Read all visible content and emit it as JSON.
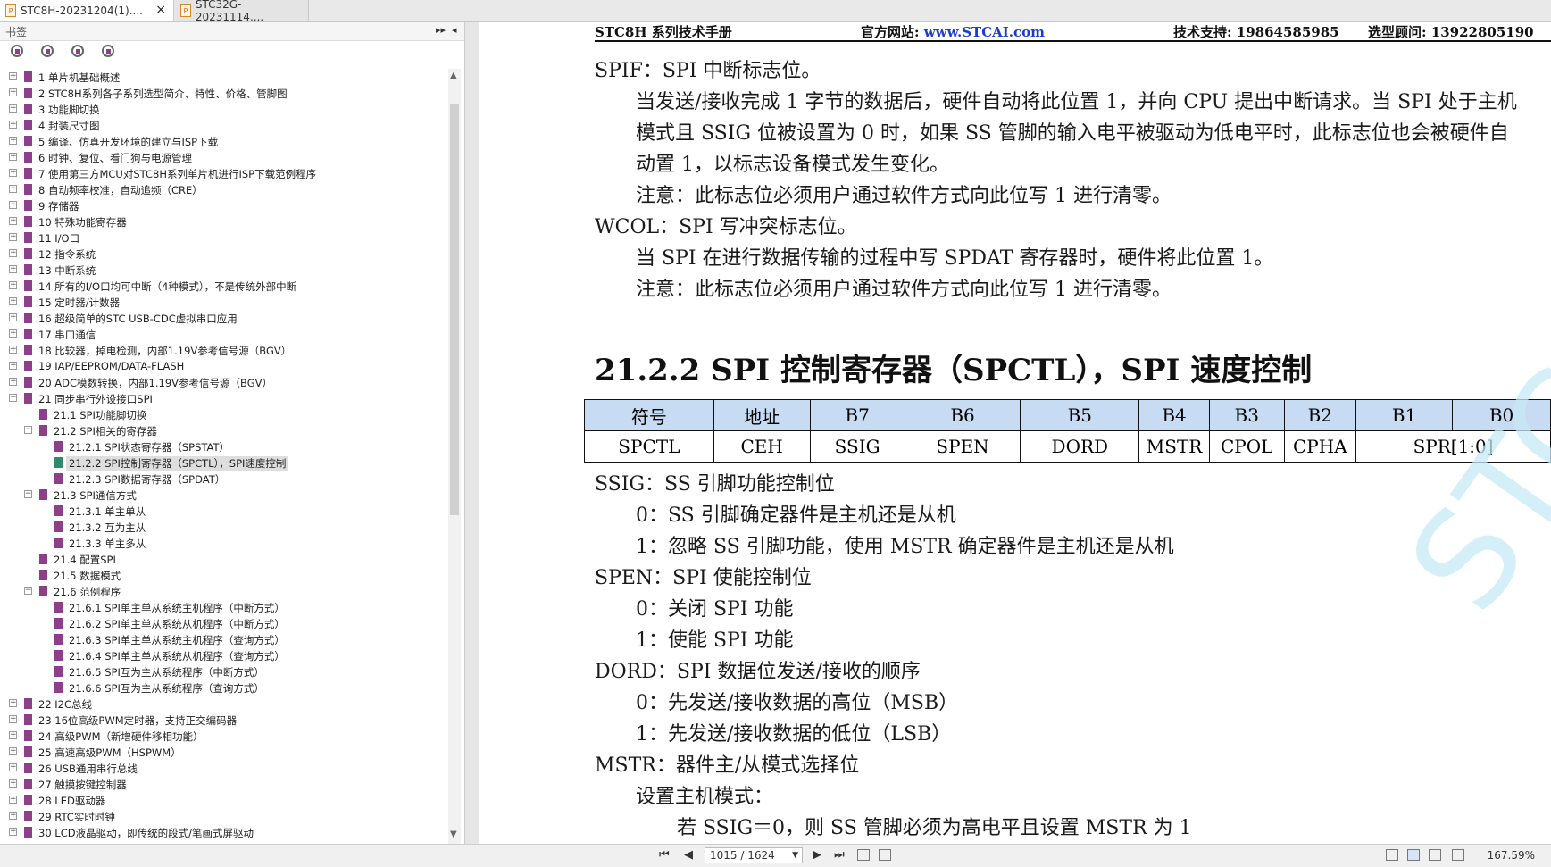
{
  "tabs": [
    {
      "label": "STC8H-20231204(1)....",
      "close": "×"
    },
    {
      "label": "STC32G-20231114...."
    }
  ],
  "sidebar": {
    "title": "书签",
    "controls": [
      "▸▸",
      "◂"
    ],
    "items": [
      {
        "level": 0,
        "exp": "+",
        "label": "1 单片机基础概述"
      },
      {
        "level": 0,
        "exp": "+",
        "label": "2  STC8H系列各子系列选型简介、特性、价格、管脚图"
      },
      {
        "level": 0,
        "exp": "+",
        "label": "3  功能脚切换"
      },
      {
        "level": 0,
        "exp": "+",
        "label": "4  封装尺寸图"
      },
      {
        "level": 0,
        "exp": "+",
        "label": "5  编译、仿真开发环境的建立与ISP下载"
      },
      {
        "level": 0,
        "exp": "+",
        "label": "6  时钟、复位、看门狗与电源管理"
      },
      {
        "level": 0,
        "exp": "+",
        "label": "7  使用第三方MCU对STC8H系列单片机进行ISP下载范例程序"
      },
      {
        "level": 0,
        "exp": "+",
        "label": "8  自动频率校准，自动追频（CRE）"
      },
      {
        "level": 0,
        "exp": "+",
        "label": "9  存储器"
      },
      {
        "level": 0,
        "exp": "+",
        "label": "10  特殊功能寄存器"
      },
      {
        "level": 0,
        "exp": "+",
        "label": "11  I/O口"
      },
      {
        "level": 0,
        "exp": "+",
        "label": "12  指令系统"
      },
      {
        "level": 0,
        "exp": "+",
        "label": "13  中断系统"
      },
      {
        "level": 0,
        "exp": "+",
        "label": "14  所有的I/O口均可中断（4种模式），不是传统外部中断"
      },
      {
        "level": 0,
        "exp": "+",
        "label": "15  定时器/计数器"
      },
      {
        "level": 0,
        "exp": "+",
        "label": "16  超级简单的STC USB-CDC虚拟串口应用"
      },
      {
        "level": 0,
        "exp": "+",
        "label": "17  串口通信"
      },
      {
        "level": 0,
        "exp": "+",
        "label": "18  比较器，掉电检测，内部1.19V参考信号源（BGV）"
      },
      {
        "level": 0,
        "exp": "+",
        "label": "19  IAP/EEPROM/DATA-FLASH"
      },
      {
        "level": 0,
        "exp": "+",
        "label": "20  ADC模数转换，内部1.19V参考信号源（BGV）"
      },
      {
        "level": 0,
        "exp": "−",
        "label": "21  同步串行外设接口SPI"
      },
      {
        "level": 1,
        "exp": "",
        "label": "21.1 SPI功能脚切换"
      },
      {
        "level": 1,
        "exp": "−",
        "label": "21.2 SPI相关的寄存器"
      },
      {
        "level": 2,
        "exp": "",
        "label": "21.2.1 SPI状态寄存器（SPSTAT）"
      },
      {
        "level": 2,
        "exp": "",
        "label": "21.2.2 SPI控制寄存器（SPCTL），SPI速度控制",
        "selected": true
      },
      {
        "level": 2,
        "exp": "",
        "label": "21.2.3 SPI数据寄存器（SPDAT）"
      },
      {
        "level": 1,
        "exp": "−",
        "label": "21.3  SPI通信方式"
      },
      {
        "level": 2,
        "exp": "",
        "label": "21.3.1 单主单从"
      },
      {
        "level": 2,
        "exp": "",
        "label": "21.3.2 互为主从"
      },
      {
        "level": 2,
        "exp": "",
        "label": "21.3.3 单主多从"
      },
      {
        "level": 1,
        "exp": "",
        "label": "21.4  配置SPI"
      },
      {
        "level": 1,
        "exp": "",
        "label": "21.5  数据模式"
      },
      {
        "level": 1,
        "exp": "−",
        "label": "21.6  范例程序"
      },
      {
        "level": 2,
        "exp": "",
        "label": "21.6.1 SPI单主单从系统主机程序（中断方式）"
      },
      {
        "level": 2,
        "exp": "",
        "label": "21.6.2 SPI单主单从系统从机程序（中断方式）"
      },
      {
        "level": 2,
        "exp": "",
        "label": "21.6.3 SPI单主单从系统主机程序（查询方式）"
      },
      {
        "level": 2,
        "exp": "",
        "label": "21.6.4 SPI单主单从系统从机程序（查询方式）"
      },
      {
        "level": 2,
        "exp": "",
        "label": "21.6.5 SPI互为主从系统程序（中断方式）"
      },
      {
        "level": 2,
        "exp": "",
        "label": "21.6.6 SPI互为主从系统程序（查询方式）"
      },
      {
        "level": 0,
        "exp": "+",
        "label": "22  I2C总线"
      },
      {
        "level": 0,
        "exp": "+",
        "label": "23  16位高级PWM定时器，支持正交编码器"
      },
      {
        "level": 0,
        "exp": "+",
        "label": "24  高级PWM（新增硬件移相功能）"
      },
      {
        "level": 0,
        "exp": "+",
        "label": "25  高速高级PWM（HSPWM）"
      },
      {
        "level": 0,
        "exp": "+",
        "label": "26  USB通用串行总线"
      },
      {
        "level": 0,
        "exp": "+",
        "label": "27  触摸按键控制器"
      },
      {
        "level": 0,
        "exp": "+",
        "label": "28  LED驱动器"
      },
      {
        "level": 0,
        "exp": "+",
        "label": "29  RTC实时时钟"
      },
      {
        "level": 0,
        "exp": "+",
        "label": "30  LCD液晶驱动，即传统的段式/笔画式屏驱动"
      }
    ]
  },
  "doc": {
    "header": {
      "manual": "STC8H 系列技术手册",
      "site_label": "官方网站: ",
      "site_url": "www.STCAI.com",
      "support": "技术支持: 19864585985",
      "advisor": "选型顾问: 13922805190"
    },
    "lines": [
      {
        "indent": 0,
        "text": "SPIF：SPI 中断标志位。"
      },
      {
        "indent": 1,
        "text": "当发送/接收完成 1 字节的数据后，硬件自动将此位置 1，并向 CPU 提出中断请求。当 SPI 处于主机"
      },
      {
        "indent": 1,
        "text": "模式且 SSIG 位被设置为 0 时，如果 SS 管脚的输入电平被驱动为低电平时，此标志位也会被硬件自"
      },
      {
        "indent": 1,
        "text": "动置 1，以标志设备模式发生变化。"
      },
      {
        "indent": 1,
        "text": "注意：此标志位必须用户通过软件方式向此位写 1 进行清零。"
      },
      {
        "indent": 0,
        "text": "WCOL：SPI 写冲突标志位。"
      },
      {
        "indent": 1,
        "text": "当 SPI 在进行数据传输的过程中写 SPDAT 寄存器时，硬件将此位置 1。"
      },
      {
        "indent": 1,
        "text": "注意：此标志位必须用户通过软件方式向此位写 1 进行清零。"
      }
    ],
    "section_title": "21.2.2    SPI 控制寄存器（SPCTL），SPI 速度控制",
    "table": {
      "header": [
        "符号",
        "地址",
        "B7",
        "B6",
        "B5",
        "B4",
        "B3",
        "B2",
        "B1",
        "B0"
      ],
      "row": [
        "SPCTL",
        "CEH",
        "SSIG",
        "SPEN",
        "DORD",
        "MSTR",
        "CPOL",
        "CPHA",
        "SPR[1:0]"
      ]
    },
    "lines2": [
      {
        "indent": 0,
        "text": "SSIG：SS 引脚功能控制位"
      },
      {
        "indent": 1,
        "text": "0：SS 引脚确定器件是主机还是从机"
      },
      {
        "indent": 1,
        "text": "1：忽略 SS 引脚功能，使用 MSTR 确定器件是主机还是从机"
      },
      {
        "indent": 0,
        "text": "SPEN：SPI 使能控制位"
      },
      {
        "indent": 1,
        "text": "0：关闭 SPI 功能"
      },
      {
        "indent": 1,
        "text": "1：使能 SPI 功能"
      },
      {
        "indent": 0,
        "text": "DORD：SPI 数据位发送/接收的顺序"
      },
      {
        "indent": 1,
        "text": "0：先发送/接收数据的高位（MSB）"
      },
      {
        "indent": 1,
        "text": "1：先发送/接收数据的低位（LSB）"
      },
      {
        "indent": 0,
        "text": "MSTR：器件主/从模式选择位"
      },
      {
        "indent": 1,
        "text": "设置主机模式："
      },
      {
        "indent": 2,
        "text": "若 SSIG＝0，则 SS 管脚必须为高电平且设置 MSTR 为 1"
      }
    ],
    "watermark": "STCMCU"
  },
  "statusbar": {
    "page": "1015 / 1624",
    "zoom": "167.59%"
  }
}
